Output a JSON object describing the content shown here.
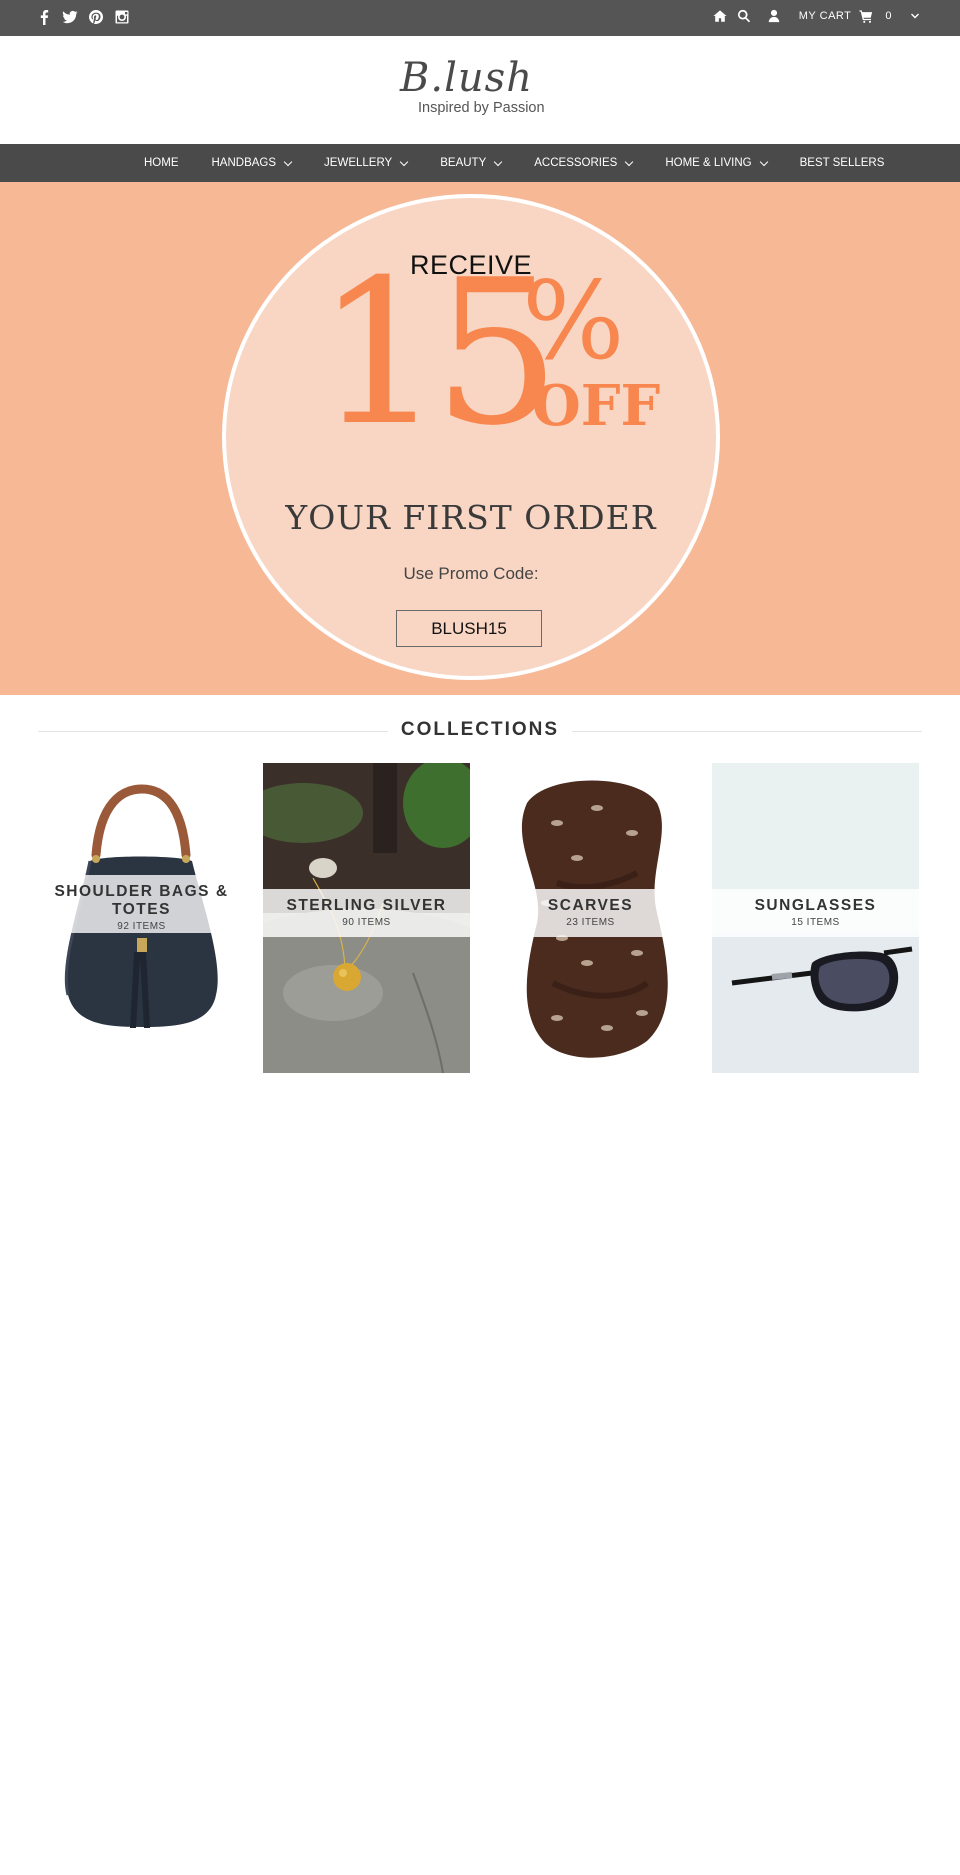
{
  "topbar": {
    "social_icons": [
      "facebook-icon",
      "twitter-icon",
      "pinterest-icon",
      "instagram-icon"
    ],
    "utility_icons": [
      "home-icon",
      "search-icon",
      "user-icon"
    ],
    "cart_label": "MY CART",
    "cart_count": "0"
  },
  "header": {
    "logo_text": "B.lush",
    "tagline": "Inspired by Passion"
  },
  "nav": {
    "items": [
      {
        "label": "HOME",
        "has_dropdown": false
      },
      {
        "label": "HANDBAGS",
        "has_dropdown": true
      },
      {
        "label": "JEWELLERY",
        "has_dropdown": true
      },
      {
        "label": "BEAUTY",
        "has_dropdown": true
      },
      {
        "label": "ACCESSORIES",
        "has_dropdown": true
      },
      {
        "label": "HOME & LIVING",
        "has_dropdown": true
      },
      {
        "label": "BEST SELLERS",
        "has_dropdown": false
      }
    ]
  },
  "hero": {
    "receive": "RECEIVE",
    "percent_number": "15",
    "percent_sign": "%",
    "off": "OFF",
    "first_order": "YOUR FIRST ORDER",
    "promo_label": "Use Promo Code:",
    "promo_code": "BLUSH15"
  },
  "collections": {
    "title": "COLLECTIONS",
    "items": [
      {
        "name": "SHOULDER BAGS & TOTES",
        "count": "92 ITEMS"
      },
      {
        "name": "STERLING SILVER",
        "count": "90 ITEMS"
      },
      {
        "name": "SCARVES",
        "count": "23 ITEMS"
      },
      {
        "name": "SUNGLASSES",
        "count": "15 ITEMS"
      }
    ]
  },
  "colors": {
    "topbar_bg": "#555555",
    "nav_bg": "#4a4a4a",
    "hero_bg": "#f7b896",
    "hero_circle": "#f9d6c4",
    "hero_accent": "#f7874f"
  }
}
